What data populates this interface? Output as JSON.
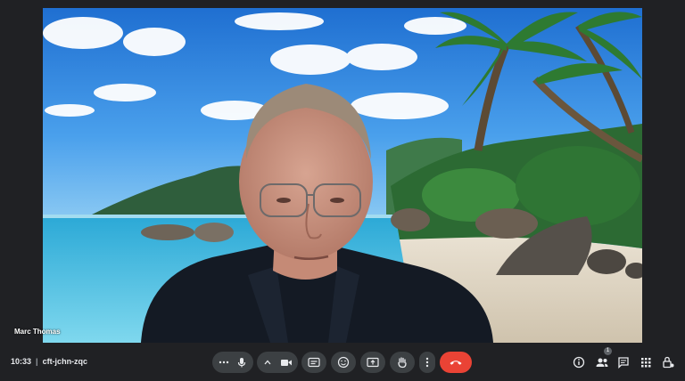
{
  "meeting": {
    "time": "10:33",
    "code": "cft-jchn-zqc"
  },
  "participant": {
    "name": "Marc Thomas"
  },
  "controls": {
    "more_options": "more-options",
    "microphone": "microphone",
    "video": "video",
    "captions": "captions",
    "reactions": "reactions",
    "present": "present",
    "raise_hand": "raise-hand",
    "more": "more",
    "leave_call": "leave-call"
  },
  "right_panel": {
    "info": "info",
    "people": "people",
    "people_count": "1",
    "chat": "chat",
    "activities": "activities",
    "host_controls": "host-controls"
  },
  "colors": {
    "leave_button": "#ea4335",
    "control_bg": "#3c4043",
    "background": "#202124"
  }
}
